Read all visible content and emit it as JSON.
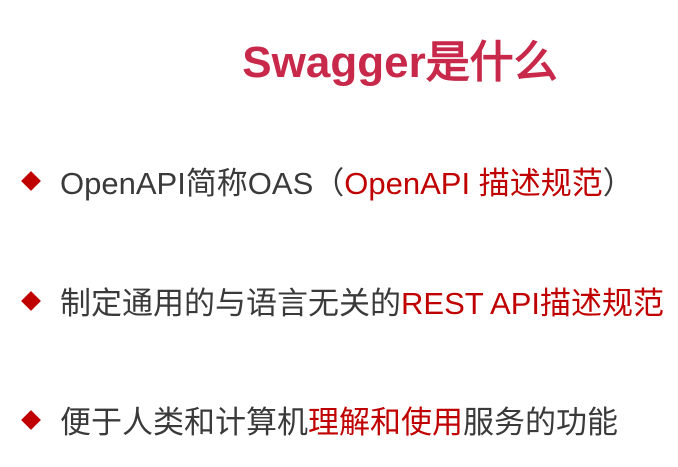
{
  "title": "Swagger是什么",
  "bullets": [
    {
      "parts": [
        {
          "text": "OpenAPI简称OAS（",
          "highlight": false
        },
        {
          "text": "OpenAPI 描述规范",
          "highlight": true
        },
        {
          "text": "）",
          "highlight": false
        }
      ]
    },
    {
      "parts": [
        {
          "text": "制定通用的与语言无关的",
          "highlight": false
        },
        {
          "text": "REST API描述规范",
          "highlight": true
        }
      ]
    },
    {
      "parts": [
        {
          "text": "便于人类和计算机",
          "highlight": false
        },
        {
          "text": "理解和使用",
          "highlight": true
        },
        {
          "text": "服务的功能",
          "highlight": false
        }
      ]
    }
  ],
  "colors": {
    "title": "#c8284a",
    "highlight": "#c00000",
    "text": "#3a3a3a",
    "bullet": "#c00000"
  }
}
